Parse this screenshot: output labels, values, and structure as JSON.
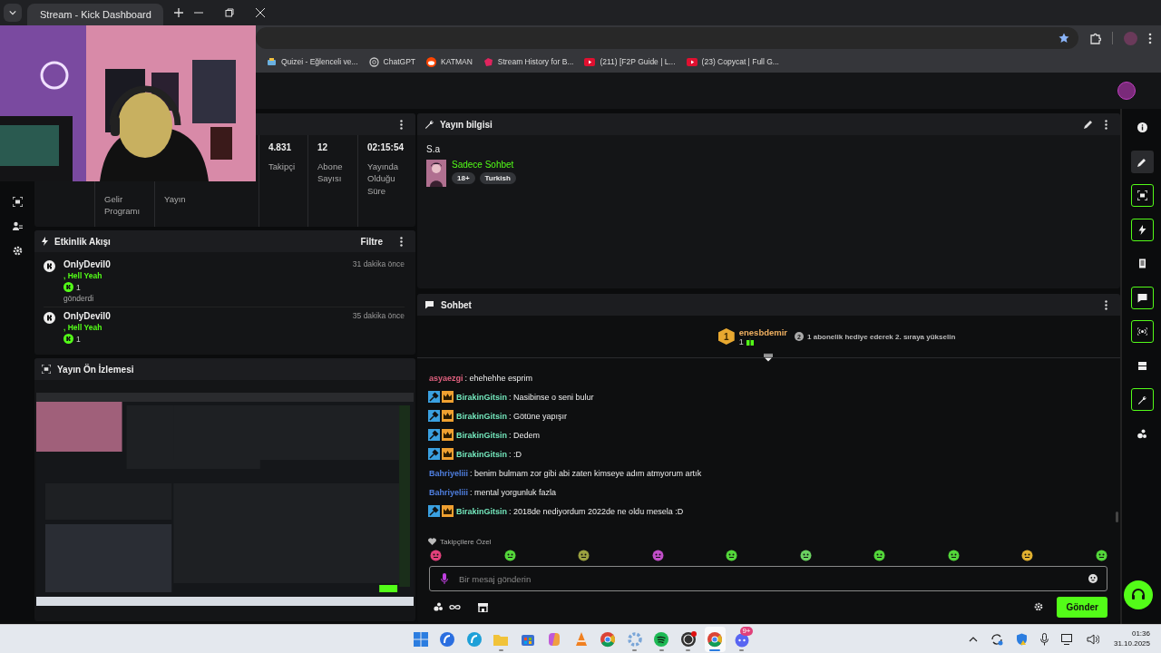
{
  "browser": {
    "tab_title": "Stream - Kick Dashboard",
    "bookmarks": [
      {
        "label": "Quizei - Eğlenceli ve...",
        "kind": "quiz"
      },
      {
        "label": "ChatGPT",
        "kind": "gpt"
      },
      {
        "label": "KATMAN",
        "kind": "reddit"
      },
      {
        "label": "Stream History for B...",
        "kind": "stream"
      },
      {
        "label": "(211) [F2P Guide | L...",
        "kind": "youtube"
      },
      {
        "label": "(23) Copycat | Full G...",
        "kind": "youtube"
      }
    ]
  },
  "stats": [
    {
      "label": "Gelir Programı"
    },
    {
      "label": "Yayın"
    },
    {
      "value": "4.831",
      "label": "Takipçi"
    },
    {
      "value": "12",
      "label": "Abone Sayısı"
    },
    {
      "value": "02:15:54",
      "label": "Yayında Olduğu Süre"
    }
  ],
  "activity": {
    "title": "Etkinlik Akışı",
    "filter": "Filtre",
    "events": [
      {
        "user": "OnlyDevil0",
        "message": ", Hell Yeah",
        "amount": "1",
        "action": "gönderdi",
        "time": "31 dakika önce"
      },
      {
        "user": "OnlyDevil0",
        "message": ", Hell Yeah",
        "amount": "1",
        "time": "35 dakika önce"
      }
    ]
  },
  "preview": {
    "title": "Yayın Ön İzlemesi"
  },
  "stream_info": {
    "title": "Yayın bilgisi",
    "stream_title": "S.a",
    "category": "Sadece Sohbet",
    "tags": [
      "18+",
      "Turkish"
    ]
  },
  "chat": {
    "title": "Sohbet",
    "top_gifter": {
      "rank": "1",
      "name": "enesbdemir",
      "count": "1"
    },
    "next_rank": {
      "rank": "2",
      "text": "1 abonelik hediye ederek 2. sıraya yükselin"
    },
    "messages": [
      {
        "user": "asyaezgi",
        "color": "#e0607e",
        "text": ": ehehehhe esprim"
      },
      {
        "user": "BirakinGitsin",
        "color": "#74e8bd",
        "badges": [
          {
            "kind": "moderator"
          },
          {
            "kind": "crown"
          }
        ],
        "text": ": Nasibinse o seni bulur"
      },
      {
        "user": "BirakinGitsin",
        "color": "#74e8bd",
        "badges": [
          {
            "kind": "moderator"
          },
          {
            "kind": "crown"
          }
        ],
        "text": ": Götüne yapışır"
      },
      {
        "user": "BirakinGitsin",
        "color": "#74e8bd",
        "badges": [
          {
            "kind": "moderator"
          },
          {
            "kind": "crown"
          }
        ],
        "text": ": Dedem"
      },
      {
        "user": "BirakinGitsin",
        "color": "#74e8bd",
        "badges": [
          {
            "kind": "moderator"
          },
          {
            "kind": "crown"
          }
        ],
        "text": ": :D"
      },
      {
        "user": "Bahriyeliii",
        "color": "#4f7fe0",
        "text": ": benim bulmam zor gibi abi zaten kimseye adım atmyorum artık"
      },
      {
        "user": "Bahriyeliii",
        "color": "#4f7fe0",
        "text": ": mental yorgunluk fazla"
      },
      {
        "user": "BirakinGitsin",
        "color": "#74e8bd",
        "badges": [
          {
            "kind": "moderator"
          },
          {
            "kind": "crown"
          }
        ],
        "text": ": 2018de nediyordum 2022de ne oldu mesela :D"
      }
    ],
    "followers_only": "Takipçilere Özel",
    "placeholder": "Bir mesaj gönderin",
    "send": "Gönder"
  },
  "right_rail": [
    {
      "kind": "info",
      "highlighted": false,
      "selected": false
    },
    {
      "kind": "pencil",
      "highlighted": false,
      "selected": true
    },
    {
      "kind": "screen",
      "highlighted": true,
      "selected": false
    },
    {
      "kind": "bolt",
      "highlighted": true,
      "selected": false
    },
    {
      "kind": "doc",
      "highlighted": false,
      "selected": false
    },
    {
      "kind": "chat",
      "highlighted": true,
      "selected": false
    },
    {
      "kind": "broadcast",
      "highlighted": true,
      "selected": false
    },
    {
      "kind": "stack",
      "highlighted": false,
      "selected": false
    },
    {
      "kind": "wrench",
      "highlighted": true,
      "selected": false
    },
    {
      "kind": "circles",
      "highlighted": false,
      "selected": false
    }
  ],
  "taskbar": {
    "apps": [
      {
        "kind": "start",
        "open": false,
        "active": false
      },
      {
        "kind": "swirl",
        "open": false,
        "active": false
      },
      {
        "kind": "edge",
        "open": false,
        "active": false
      },
      {
        "kind": "folder",
        "open": true,
        "active": false
      },
      {
        "kind": "store",
        "open": false,
        "active": false
      },
      {
        "kind": "copilot",
        "open": false,
        "active": false
      },
      {
        "kind": "cone",
        "open": false,
        "active": false
      },
      {
        "kind": "chrome",
        "open": false,
        "active": false
      },
      {
        "kind": "gear",
        "open": true,
        "active": false
      },
      {
        "kind": "spotify",
        "open": true,
        "active": false
      },
      {
        "kind": "obs",
        "open": true,
        "active": false
      },
      {
        "kind": "chrome",
        "open": true,
        "active": true
      },
      {
        "kind": "discord",
        "open": true,
        "active": false,
        "badge": "9+"
      }
    ],
    "time": "01:36",
    "date": "31.10.2025"
  }
}
